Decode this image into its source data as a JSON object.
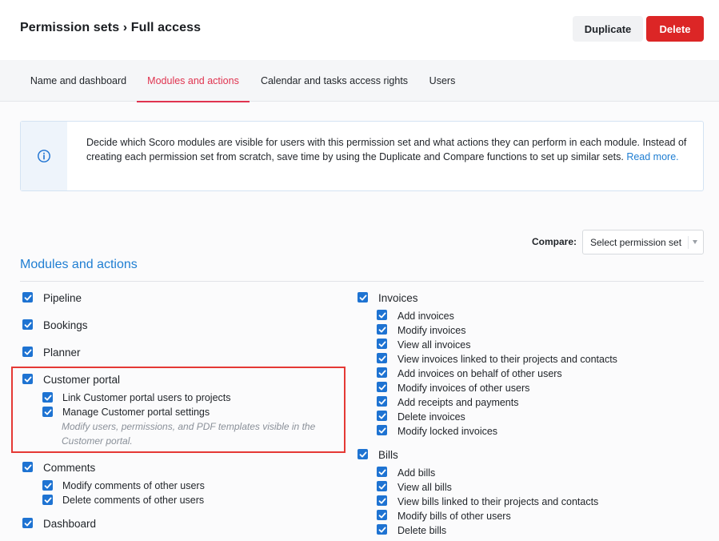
{
  "header": {
    "title": "Permission sets › Full access",
    "duplicate_label": "Duplicate",
    "delete_label": "Delete"
  },
  "tabs": [
    {
      "label": "Name and dashboard",
      "active": false
    },
    {
      "label": "Modules and actions",
      "active": true
    },
    {
      "label": "Calendar and tasks access rights",
      "active": false
    },
    {
      "label": "Users",
      "active": false
    }
  ],
  "info": {
    "text": "Decide which Scoro modules are visible for users with this permission set and what actions they can perform in each module. Instead of creating each permission set from scratch, save time by using the Duplicate and Compare functions to set up similar sets. ",
    "link": "Read more."
  },
  "compare": {
    "label": "Compare:",
    "placeholder": "Select permission set"
  },
  "section": {
    "title": "Modules and actions"
  },
  "left_modules": {
    "pipeline": "Pipeline",
    "bookings": "Bookings",
    "planner": "Planner",
    "customer_portal": {
      "label": "Customer portal",
      "actions": [
        "Link Customer portal users to projects",
        "Manage Customer portal settings"
      ],
      "description": "Modify users, permissions, and PDF templates visible in the Customer portal."
    },
    "comments": {
      "label": "Comments",
      "actions": [
        "Modify comments of other users",
        "Delete comments of other users"
      ]
    },
    "dashboard": "Dashboard"
  },
  "right_modules": {
    "invoices": {
      "label": "Invoices",
      "actions": [
        "Add invoices",
        "Modify invoices",
        "View all invoices",
        "View invoices linked to their projects and contacts",
        "Add invoices on behalf of other users",
        "Modify invoices of other users",
        "Add receipts and payments",
        "Delete invoices",
        "Modify locked invoices"
      ]
    },
    "bills": {
      "label": "Bills",
      "actions": [
        "Add bills",
        "View all bills",
        "View bills linked to their projects and contacts",
        "Modify bills of other users",
        "Delete bills"
      ]
    }
  },
  "colors": {
    "accent_blue": "#1e73d2",
    "active_tab": "#e0334f",
    "delete_red": "#dc2626",
    "highlight_red": "#e53935"
  }
}
